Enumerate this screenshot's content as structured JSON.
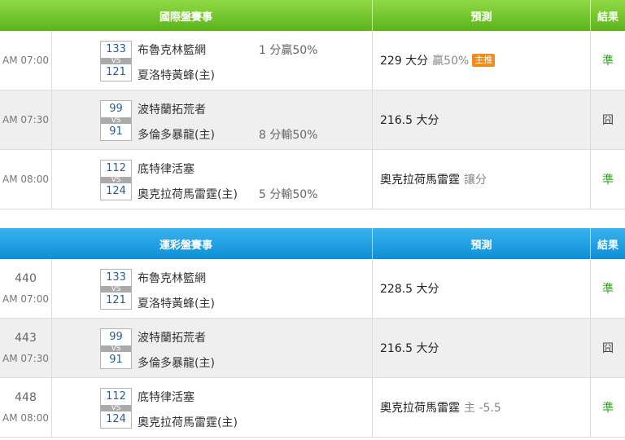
{
  "sections": [
    {
      "header": {
        "event": "國際盤賽事",
        "prediction": "預測",
        "result": "結果"
      },
      "rows": [
        {
          "num": "",
          "time": "AM 07:00",
          "score1": "133",
          "score2": "121",
          "vs": "VS",
          "team1": "布魯克林籃網",
          "team2": "夏洛特黃蜂(主)",
          "odds": "1 分贏50%",
          "odds_row": 1,
          "pred_main": "229 大分",
          "pred_sub": "贏50%",
          "badge": "主推",
          "result": "準",
          "result_type": "win"
        },
        {
          "num": "",
          "time": "AM 07:30",
          "score1": "99",
          "score2": "91",
          "vs": "VS",
          "team1": "波特蘭拓荒者",
          "team2": "多倫多暴龍(主)",
          "odds": "8 分輸50%",
          "odds_row": 2,
          "pred_main": "216.5 大分",
          "pred_sub": "",
          "badge": "",
          "result": "囧",
          "result_type": "lose"
        },
        {
          "num": "",
          "time": "AM 08:00",
          "score1": "112",
          "score2": "124",
          "vs": "VS",
          "team1": "底特律活塞",
          "team2": "奧克拉荷馬雷霆(主)",
          "odds": "5 分輸50%",
          "odds_row": 2,
          "pred_main": "奧克拉荷馬雷霆",
          "pred_sub": "讓分",
          "badge": "",
          "result": "準",
          "result_type": "win"
        }
      ]
    },
    {
      "header": {
        "event": "運彩盤賽事",
        "prediction": "預測",
        "result": "結果"
      },
      "rows": [
        {
          "num": "440",
          "time": "AM 07:00",
          "score1": "133",
          "score2": "121",
          "vs": "VS",
          "team1": "布魯克林籃網",
          "team2": "夏洛特黃蜂(主)",
          "odds": "",
          "odds_row": 1,
          "pred_main": "228.5 大分",
          "pred_sub": "",
          "badge": "",
          "result": "準",
          "result_type": "win"
        },
        {
          "num": "443",
          "time": "AM 07:30",
          "score1": "99",
          "score2": "91",
          "vs": "VS",
          "team1": "波特蘭拓荒者",
          "team2": "多倫多暴龍(主)",
          "odds": "",
          "odds_row": 1,
          "pred_main": "216.5 大分",
          "pred_sub": "",
          "badge": "",
          "result": "囧",
          "result_type": "lose"
        },
        {
          "num": "448",
          "time": "AM 08:00",
          "score1": "112",
          "score2": "124",
          "vs": "VS",
          "team1": "底特律活塞",
          "team2": "奧克拉荷馬雷霆(主)",
          "odds": "",
          "odds_row": 1,
          "pred_main": "奧克拉荷馬雷霆",
          "pred_sub": "主 -5.5",
          "badge": "",
          "result": "準",
          "result_type": "win"
        }
      ]
    }
  ],
  "colors": {
    "intl_header": "#6cc12a",
    "lottery_header": "#1b9de2",
    "win": "#3c9a2c",
    "badge": "#f08c1c",
    "score": "#2a5f8f"
  }
}
